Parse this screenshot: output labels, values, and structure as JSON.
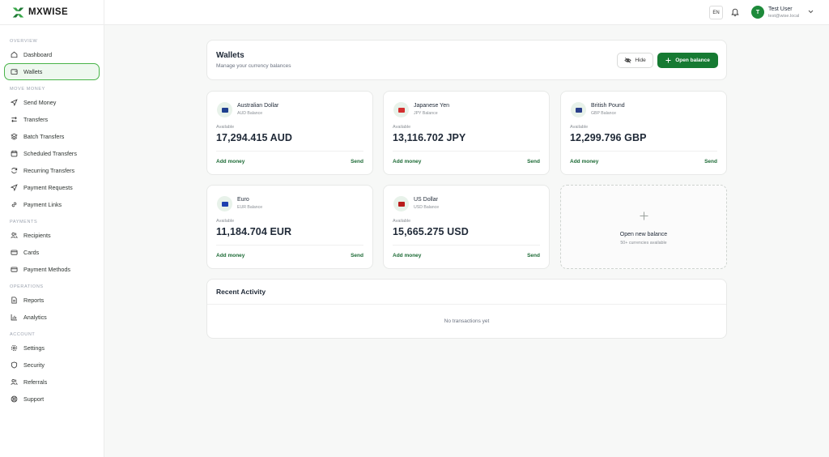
{
  "app": {
    "brand": "MXWISE"
  },
  "sidebar": {
    "sections": [
      {
        "label": "OVERVIEW",
        "items": [
          {
            "label": "Dashboard",
            "icon": "home-icon"
          },
          {
            "label": "Wallets",
            "icon": "wallet-icon",
            "active": true
          }
        ]
      },
      {
        "label": "MOVE MONEY",
        "items": [
          {
            "label": "Send Money",
            "icon": "send-icon"
          },
          {
            "label": "Transfers",
            "icon": "transfer-icon"
          },
          {
            "label": "Batch Transfers",
            "icon": "stack-icon"
          },
          {
            "label": "Scheduled Transfers",
            "icon": "calendar-icon"
          },
          {
            "label": "Recurring Transfers",
            "icon": "refresh-icon"
          },
          {
            "label": "Payment Requests",
            "icon": "send-icon"
          },
          {
            "label": "Payment Links",
            "icon": "link-icon"
          }
        ]
      },
      {
        "label": "PAYMENTS",
        "items": [
          {
            "label": "Recipients",
            "icon": "users-icon"
          },
          {
            "label": "Cards",
            "icon": "card-icon"
          },
          {
            "label": "Payment Methods",
            "icon": "card-icon"
          }
        ]
      },
      {
        "label": "OPERATIONS",
        "items": [
          {
            "label": "Reports",
            "icon": "document-icon"
          },
          {
            "label": "Analytics",
            "icon": "chart-icon"
          }
        ]
      },
      {
        "label": "ACCOUNT",
        "items": [
          {
            "label": "Settings",
            "icon": "gear-icon"
          },
          {
            "label": "Security",
            "icon": "shield-icon"
          },
          {
            "label": "Referrals",
            "icon": "users-icon"
          },
          {
            "label": "Support",
            "icon": "lifebuoy-icon"
          }
        ]
      }
    ]
  },
  "header": {
    "language": "EN",
    "user_initial": "T",
    "user_name": "Test User",
    "user_email": "test@wise.local"
  },
  "page": {
    "title": "Wallets",
    "subtitle": "Manage your currency balances",
    "hide_label": "Hide",
    "open_balance_label": "Open balance"
  },
  "wallets": [
    {
      "name": "Australian Dollar",
      "sub": "AUD Balance",
      "available_label": "Available",
      "amount": "17,294.415 AUD",
      "add": "Add money",
      "send": "Send",
      "flag_color": "#1f3f8f"
    },
    {
      "name": "Japanese Yen",
      "sub": "JPY Balance",
      "available_label": "Available",
      "amount": "13,116.702 JPY",
      "add": "Add money",
      "send": "Send",
      "flag_color": "#d32f2f"
    },
    {
      "name": "British Pound",
      "sub": "GBP Balance",
      "available_label": "Available",
      "amount": "12,299.796 GBP",
      "add": "Add money",
      "send": "Send",
      "flag_color": "#2a3f8a"
    },
    {
      "name": "Euro",
      "sub": "EUR Balance",
      "available_label": "Available",
      "amount": "11,184.704 EUR",
      "add": "Add money",
      "send": "Send",
      "flag_color": "#1e40af"
    },
    {
      "name": "US Dollar",
      "sub": "USD Balance",
      "available_label": "Available",
      "amount": "15,665.275 USD",
      "add": "Add money",
      "send": "Send",
      "flag_color": "#b91c1c"
    }
  ],
  "new_balance": {
    "title": "Open new balance",
    "subtitle": "50+ currencies available"
  },
  "activity": {
    "title": "Recent Activity",
    "empty": "No transactions yet"
  },
  "colors": {
    "brand_green": "#167a32",
    "active_border": "#49b449"
  }
}
